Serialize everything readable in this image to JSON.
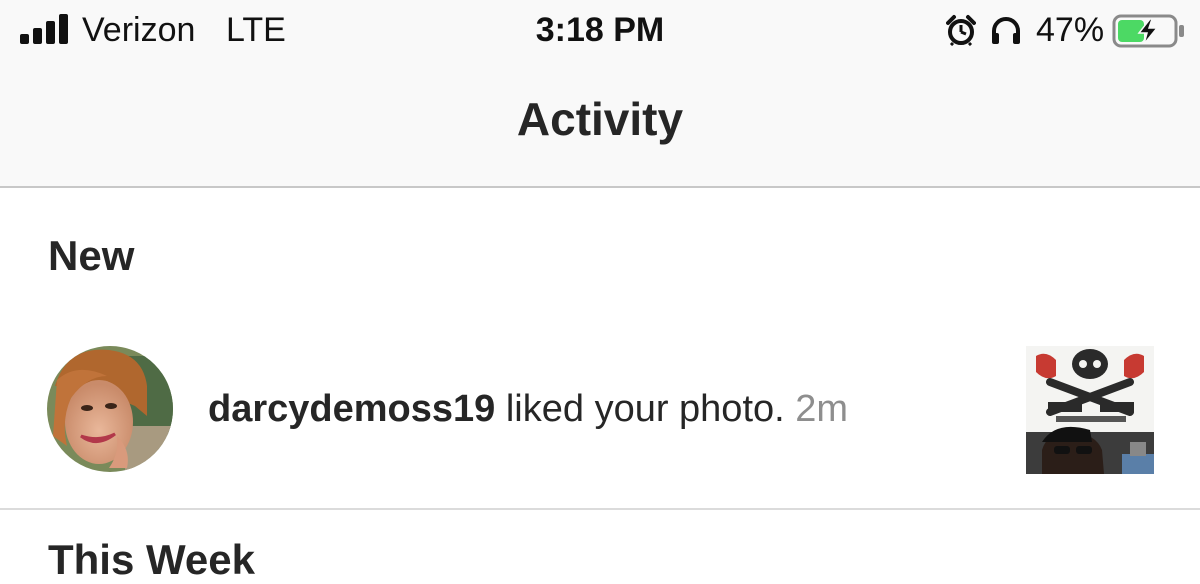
{
  "status_bar": {
    "carrier": "Verizon",
    "network": "LTE",
    "time": "3:18 PM",
    "battery_percent": "47%",
    "battery_level": 0.47,
    "battery_color": "#4cd964",
    "icons": [
      "signal-icon",
      "alarm-icon",
      "headphones-icon",
      "battery-icon"
    ]
  },
  "header": {
    "title": "Activity"
  },
  "sections": [
    {
      "title": "New",
      "items": [
        {
          "username": "darcydemoss19",
          "action": " liked your photo. ",
          "time": "2m"
        }
      ]
    },
    {
      "title": "This Week"
    }
  ],
  "colors": {
    "text_primary": "#262626",
    "text_secondary": "#8e8e8e",
    "header_bg": "#f9f9f9",
    "divider": "#dbdbdb"
  }
}
